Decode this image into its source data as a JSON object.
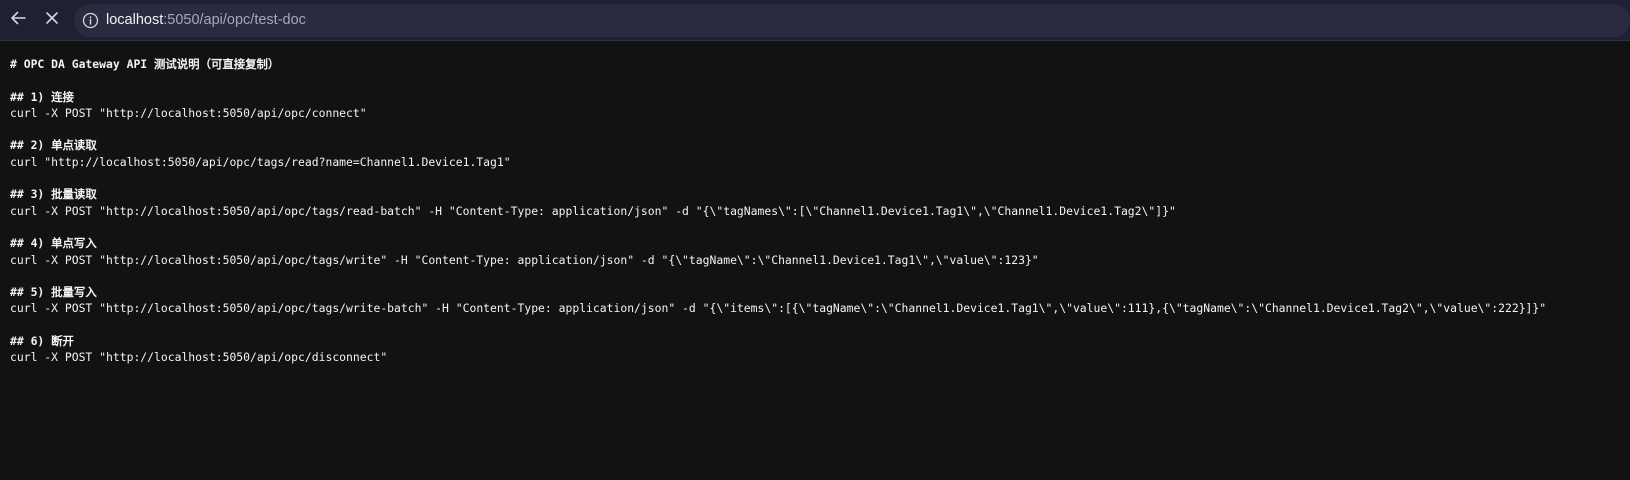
{
  "browser": {
    "address_host": "localhost",
    "address_rest": ":5050/api/opc/test-doc"
  },
  "document": {
    "title": "# OPC DA Gateway API 测试说明（可直接复制）",
    "sections": [
      {
        "heading": "## 1) 连接",
        "command": "curl -X POST \"http://localhost:5050/api/opc/connect\""
      },
      {
        "heading": "## 2) 单点读取",
        "command": "curl \"http://localhost:5050/api/opc/tags/read?name=Channel1.Device1.Tag1\""
      },
      {
        "heading": "## 3) 批量读取",
        "command": "curl -X POST \"http://localhost:5050/api/opc/tags/read-batch\" -H \"Content-Type: application/json\" -d \"{\\\"tagNames\\\":[\\\"Channel1.Device1.Tag1\\\",\\\"Channel1.Device1.Tag2\\\"]}\""
      },
      {
        "heading": "## 4) 单点写入",
        "command": "curl -X POST \"http://localhost:5050/api/opc/tags/write\" -H \"Content-Type: application/json\" -d \"{\\\"tagName\\\":\\\"Channel1.Device1.Tag1\\\",\\\"value\\\":123}\""
      },
      {
        "heading": "## 5) 批量写入",
        "command": "curl -X POST \"http://localhost:5050/api/opc/tags/write-batch\" -H \"Content-Type: application/json\" -d \"{\\\"items\\\":[{\\\"tagName\\\":\\\"Channel1.Device1.Tag1\\\",\\\"value\\\":111},{\\\"tagName\\\":\\\"Channel1.Device1.Tag2\\\",\\\"value\\\":222}]}\""
      },
      {
        "heading": "## 6) 断开",
        "command": "curl -X POST \"http://localhost:5050/api/opc/disconnect\""
      }
    ]
  }
}
